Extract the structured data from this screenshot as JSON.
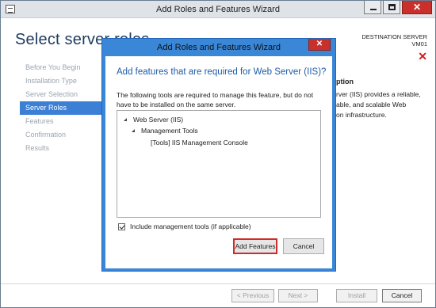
{
  "window": {
    "title": "Add Roles and Features Wizard",
    "heading": "Select server roles",
    "destination_label": "DESTINATION SERVER",
    "destination_server": "VM01"
  },
  "nav": {
    "items": [
      {
        "label": "Before You Begin",
        "active": false
      },
      {
        "label": "Installation Type",
        "active": false
      },
      {
        "label": "Server Selection",
        "active": false
      },
      {
        "label": "Server Roles",
        "active": true
      },
      {
        "label": "Features",
        "active": false
      },
      {
        "label": "Confirmation",
        "active": false
      },
      {
        "label": "Results",
        "active": false
      }
    ]
  },
  "description": {
    "heading": "ption",
    "line1": "rver (IIS) provides a reliable,",
    "line2": "able, and scalable Web",
    "line3": "on infrastructure."
  },
  "footer": {
    "previous": "< Previous",
    "next": "Next >",
    "install": "Install",
    "cancel": "Cancel"
  },
  "dialog": {
    "title": "Add Roles and Features Wizard",
    "close": "✕",
    "heading": "Add features that are required for Web Server (IIS)?",
    "text": "The following tools are required to manage this feature, but do not have to be installed on the same server.",
    "tree": [
      "Web Server (IIS)",
      "Management Tools",
      "[Tools] IIS Management Console"
    ],
    "include_label": "Include management tools (if applicable)",
    "include_checked": true,
    "add_button": "Add Features",
    "cancel_button": "Cancel"
  }
}
